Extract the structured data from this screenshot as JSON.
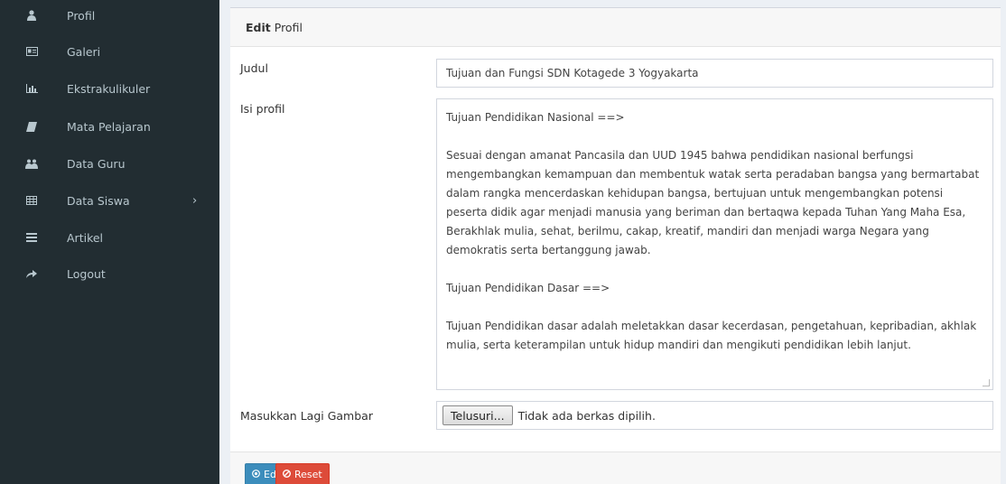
{
  "sidebar": {
    "items": [
      {
        "label": "Profil",
        "icon": "user-icon"
      },
      {
        "label": "Galeri",
        "icon": "id-card-icon"
      },
      {
        "label": "Ekstrakulikuler",
        "icon": "bar-chart-icon"
      },
      {
        "label": "Mata Pelajaran",
        "icon": "book-icon"
      },
      {
        "label": "Data Guru",
        "icon": "users-icon"
      },
      {
        "label": "Data Siswa",
        "icon": "table-icon",
        "chevron": "›"
      },
      {
        "label": "Artikel",
        "icon": "list-icon"
      },
      {
        "label": "Logout",
        "icon": "share-icon"
      }
    ]
  },
  "box": {
    "header_bold": "Edit",
    "header_rest": "Profil"
  },
  "form": {
    "judul_label": "Judul",
    "judul_value": "Tujuan dan Fungsi SDN Kotagede 3 Yogyakarta",
    "isi_label": "Isi profil",
    "isi_paragraphs": [
      "Tujuan Pendidikan Nasional ==>",
      "Sesuai dengan amanat Pancasila dan UUD 1945 bahwa pendidikan nasional berfungsi mengembangkan kemampuan dan membentuk watak serta peradaban bangsa yang bermartabat dalam rangka mencerdaskan kehidupan bangsa, bertujuan untuk mengembangkan potensi peserta didik agar menjadi manusia yang beriman dan bertaqwa kepada Tuhan Yang Maha Esa, Berakhlak mulia, sehat, berilmu, cakap, kreatif, mandiri dan menjadi warga Negara yang demokratis serta bertanggung jawab.",
      "Tujuan Pendidikan Dasar ==>",
      "Tujuan Pendidikan dasar adalah meletakkan dasar kecerdasan, pengetahuan, kepribadian, akhlak mulia, serta keterampilan untuk hidup mandiri dan mengikuti pendidikan lebih lanjut."
    ],
    "gambar_label": "Masukkan Lagi Gambar",
    "browse_label": "Telusuri...",
    "file_status": "Tidak ada berkas dipilih."
  },
  "footer": {
    "edit_label": "Edit",
    "reset_label": "Reset"
  },
  "colors": {
    "sidebar_bg": "#222d32",
    "primary": "#3c8dbc",
    "danger": "#dd4b39"
  }
}
